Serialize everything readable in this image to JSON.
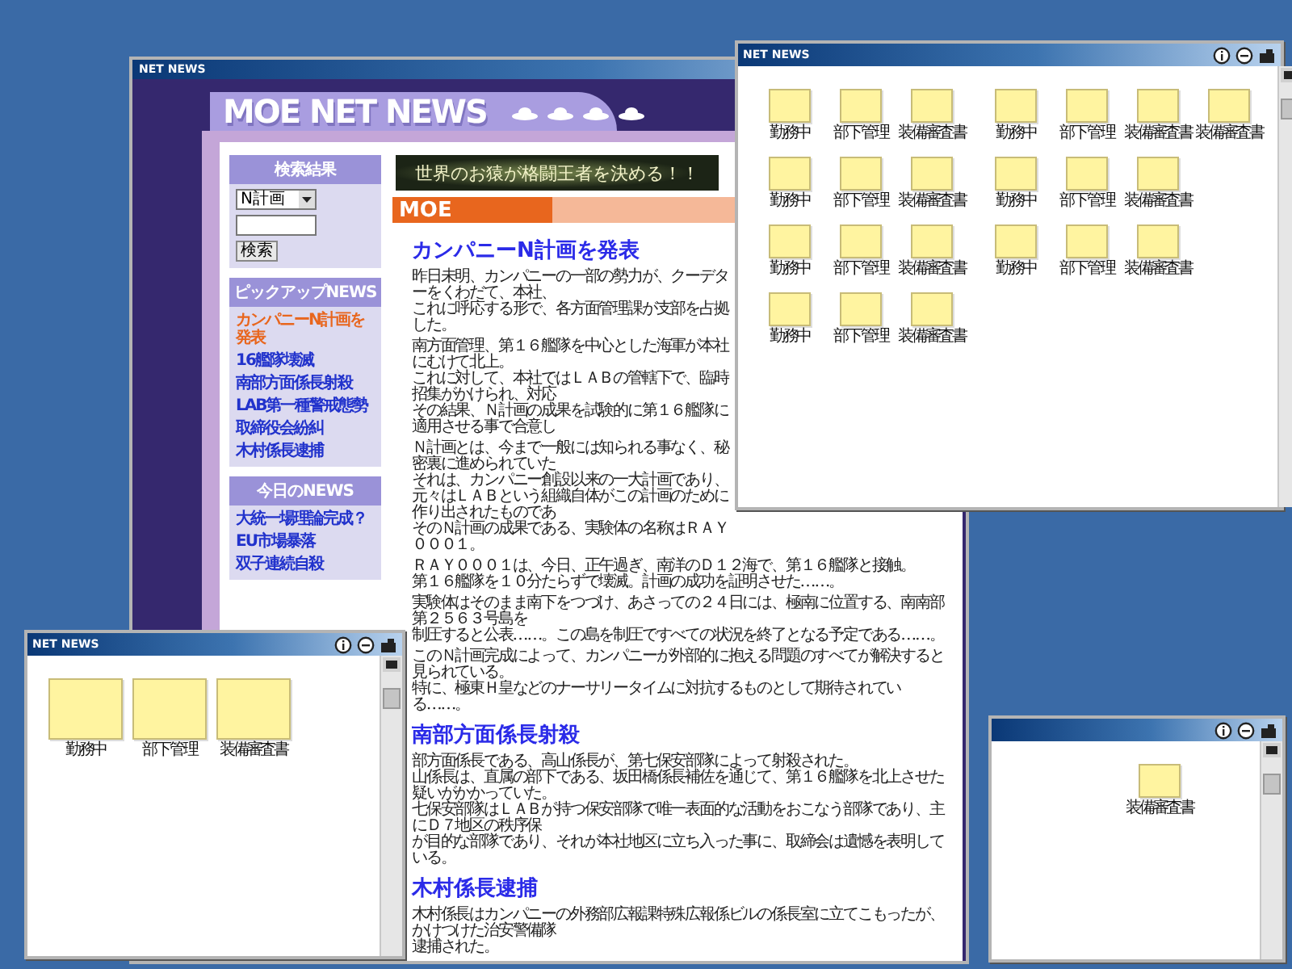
{
  "main_window": {
    "title": "NET NEWS",
    "logo": "MOE NET NEWS",
    "search_box": {
      "heading": "検索結果",
      "select_value": "N計画",
      "button": "検索"
    },
    "pickup_news": {
      "heading": "ピックアップNEWS",
      "items": [
        {
          "label": "カンパニーN計画を発表",
          "selected": true
        },
        {
          "label": "16艦隊壊滅",
          "selected": false
        },
        {
          "label": "南部方面係長射殺",
          "selected": false
        },
        {
          "label": "LAB第一種警戒態勢",
          "selected": false
        },
        {
          "label": "取締役会紛糾",
          "selected": false
        },
        {
          "label": "木村係長逮捕",
          "selected": false
        }
      ]
    },
    "today_news": {
      "heading": "今日のNEWS",
      "items": [
        "大統一場理論完成？",
        "EU市場暴落",
        "双子連続自殺"
      ]
    },
    "banner": "世界のお猿が格闘王者を決める！！",
    "section_bar": "MOE",
    "articles": [
      {
        "heading": "カンパニーN計画を発表",
        "paragraphs": [
          [
            "昨日未明、カンパニーの一部の勢力が、クーデターをくわだて、本社、",
            "これに呼応する形で、各方面管理課が支部を占拠した。"
          ],
          [
            "南方面管理、第１６艦隊を中心とした海軍が本社にむけて北上。",
            "これに対して、本社ではＬＡＢの管轄下で、臨時招集がかけられ、対応",
            "その結果、Ｎ計画の成果を試験的に第１６艦隊に適用させる事で合意し"
          ],
          [
            "Ｎ計画とは、今まで一般には知られる事なく、秘密裏に進められていた",
            "それは、カンパニー創設以来の一大計画であり、",
            "元々はＬＡＢという組織自体がこの計画のために作り出されたものであ",
            "そのＮ計画の成果である、実験体の名称はＲＡＹ０００１。"
          ],
          [
            "ＲＡＹ０００１は、今日、正午過ぎ、南洋のＤ１２海で、第１６艦隊と接触。",
            "第１６艦隊を１０分たらずで壊滅。計画の成功を証明させた……。"
          ],
          [
            "実験体はそのまま南下をつづけ、あさっての２４日には、極南に位置する、南南部第２５６３号島を",
            "制圧すると公表……。この島を制圧ですべての状況を終了となる予定である……。"
          ],
          [
            "このＮ計画完成によって、カンパニーが外部的に抱える問題のすべてが解決すると見られている。",
            "特に、極東Ｈ皇などのナーサリータイムに対抗するものとして期待されている……。"
          ]
        ]
      },
      {
        "heading": "南部方面係長射殺",
        "paragraphs": [
          [
            "部方面係長である、高山係長が、第七保安部隊によって射殺された。",
            "山係長は、直属の部下である、坂田橋係長補佐を通じて、第１６艦隊を北上させた疑いがかかっていた。",
            "七保安部隊はＬＡＢが持つ保安部隊で唯一表面的な活動をおこなう部隊であり、主にＤ７地区の秩序保",
            "が目的な部隊であり、それが本社地区に立ち入った事に、取締会は遺憾を表明している。"
          ]
        ]
      },
      {
        "heading": "木村係長逮捕",
        "paragraphs": [
          [
            "木村係長はカンパニーの外務部広報課特殊広報係ビルの係長室に立てこもったが、かけつけた治安警備隊",
            "逮捕された。"
          ]
        ]
      }
    ]
  },
  "windows": [
    {
      "title": "NET NEWS",
      "icon_rows": [
        [
          "勤務中",
          "部下管理",
          "装備審査書",
          "勤務中",
          "部下管理",
          "装備審査書",
          "装備審査書"
        ],
        [
          "勤務中",
          "部下管理",
          "装備審査書",
          "勤務中",
          "部下管理",
          "装備審査書"
        ],
        [
          "勤務中",
          "部下管理",
          "装備審査書",
          "勤務中",
          "部下管理",
          "装備審査書"
        ],
        [
          "勤務中",
          "部下管理",
          "装備審査書"
        ]
      ]
    },
    {
      "title": "NET NEWS",
      "icon_rows": [
        [
          "勤務中",
          "部下管理",
          "装備審査書"
        ]
      ]
    },
    {
      "icon_rows": [
        [
          "装備審査書"
        ]
      ]
    }
  ]
}
